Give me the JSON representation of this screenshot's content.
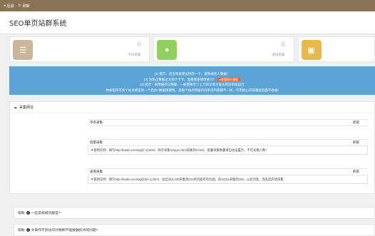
{
  "topbar": {
    "back_label": "后退",
    "refresh_label": "刷新"
  },
  "page": {
    "title": "SEO单页站群系统"
  },
  "stats": [
    {
      "value": "0",
      "label": "今日采集",
      "color": "#c9b79c",
      "icon": "list-icon"
    },
    {
      "value": "0",
      "label": "请设采集",
      "color": "#8fd15c",
      "icon": "circle-icon"
    },
    {
      "value": "",
      "label": "",
      "color": "#e8b84a",
      "icon": "briefcase-icon"
    }
  ],
  "notice": {
    "line1": "(1) 提示：后台目录建议修改一下，避免被他人猜破！",
    "line2": "(2) 为防止数据过大统计卡卡，直接联系修改统计！",
    "badge": "●查看统计最新",
    "line3": "(3) 提示：采用缓存已预缓，一般需要至少上万的文章才能去爬取系统运行",
    "line4": "你本程序可多个站点绑定同一个后台+数据库使用，且每个站点所展示的单页内容都不一样，不用担心内容重复后面不收录!"
  },
  "panel": {
    "title": "采集网址",
    "rows": [
      {
        "title": "单条采集",
        "action": "抓取",
        "body": ""
      },
      {
        "title": "批量采集",
        "action": "抓取",
        "body": "▼使用实例：填写http://baidu.com/qq/[1-3].html，例子采集从/qq/1.html采集到3.html，批量采集数量请自动设置合，不可长输入数！"
      },
      {
        "title": "递增采集",
        "action": "抓取",
        "body": "▼使用实例：填写http://baidu.com/qq/[100+1].html，会自动从100采集到101的页面所有页面，再从101采集到106，以此为准，连乱起后请采集"
      }
    ]
  },
  "help": [
    {
      "label": "帮助",
      "text": "一些常规城问解答?"
    },
    {
      "label": "帮助",
      "text": "文章咋不到访问计数刷不能接触技术的问题?"
    }
  ]
}
